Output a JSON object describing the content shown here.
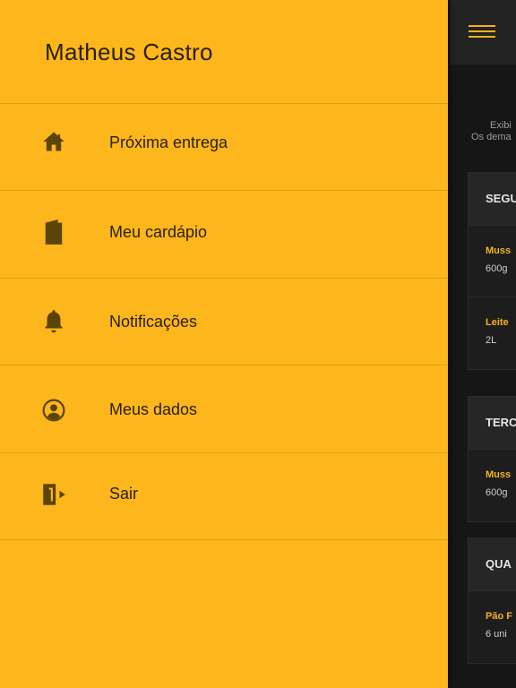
{
  "drawer": {
    "user_name": "Matheus Castro",
    "items": [
      {
        "label": "Próxima entrega",
        "icon": "home-icon"
      },
      {
        "label": "Meu cardápio",
        "icon": "book-icon"
      },
      {
        "label": "Notificações",
        "icon": "bell-icon"
      },
      {
        "label": "Meus dados",
        "icon": "account-circle-icon"
      },
      {
        "label": "Sair",
        "icon": "exit-door-icon"
      }
    ]
  },
  "background": {
    "info_line1": "Exibi",
    "info_line2": "Os dema",
    "days": [
      {
        "head": "SEGU",
        "items": [
          {
            "name": "Muss",
            "qty": "600g"
          },
          {
            "name": "Leite",
            "qty": "2L"
          }
        ]
      },
      {
        "head": "TERC",
        "items": [
          {
            "name": "Muss",
            "qty": "600g"
          }
        ]
      },
      {
        "head": "QUA",
        "items": [
          {
            "name": "Pão F",
            "qty": "6 uni"
          }
        ]
      }
    ]
  },
  "colors": {
    "drawer_bg": "#fdb61b",
    "accent": "#f5b21b",
    "text_dark": "#2a2106",
    "app_bg": "#161616"
  }
}
